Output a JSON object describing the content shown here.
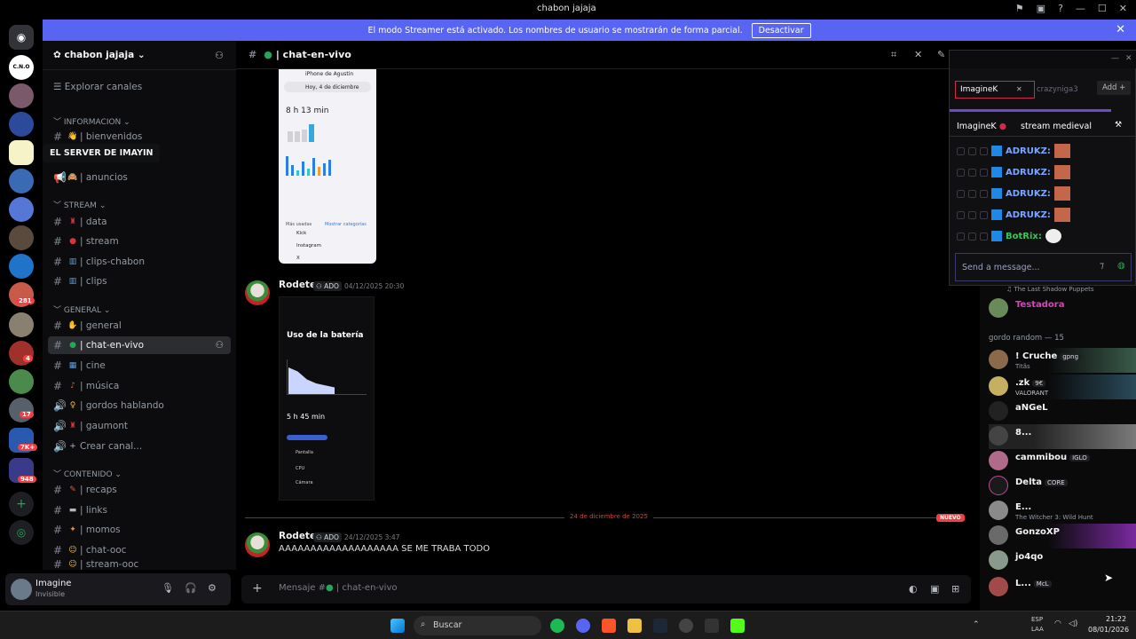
{
  "window": {
    "title": "chabon jajaja"
  },
  "banner": {
    "text": "El modo Streamer está activado. Los nombres de usuario se mostrarán de forma parcial.",
    "button": "Desactivar"
  },
  "rail": {
    "server1_label": "C.N.O",
    "badges": [
      "281",
      "4",
      "17",
      "7K+",
      "948"
    ],
    "tooltip": "EL SERVER DE IMAYIN"
  },
  "server": {
    "name": "chabon jajaja",
    "explore": "Explorar canales",
    "categories": {
      "info": "INFORMACION",
      "stream": "STREAM",
      "general": "GENERAL",
      "contenido": "CONTENIDO"
    },
    "channels": [
      {
        "label": "| bienvenidos"
      },
      {
        "label": "| anuncios"
      },
      {
        "label": "| data"
      },
      {
        "label": "| stream"
      },
      {
        "label": "| clips-chabon"
      },
      {
        "label": "| clips"
      },
      {
        "label": "| general"
      },
      {
        "label": "| chat-en-vivo"
      },
      {
        "label": "| cine"
      },
      {
        "label": "| música"
      },
      {
        "label": "| gordos hablando"
      },
      {
        "label": "| gaumont"
      },
      {
        "label": "Crear canal..."
      },
      {
        "label": "| recaps"
      },
      {
        "label": "| links"
      },
      {
        "label": "| momos"
      },
      {
        "label": "| chat-ooc"
      },
      {
        "label": "| stream-ooc"
      }
    ]
  },
  "user": {
    "name": "Imagine",
    "status": "Invisible"
  },
  "chat": {
    "channel": "| chat-en-vivo",
    "screenshot1": {
      "header": "iPhone de Agustin",
      "date": "Hoy, 4 de diciembre",
      "time": "8 h 13 min",
      "apps": [
        "Kick",
        "Instagram",
        "X"
      ],
      "link": "Mostrar categorías",
      "usage_label": "Más usadas"
    },
    "messages": [
      {
        "author": "Rodete",
        "tag": "ADO",
        "time": "04/12/2025 20:30",
        "text": ""
      },
      {
        "author": "Rodete",
        "tag": "ADO",
        "time": "24/12/2025 3:47",
        "text": "AAAAAAAAAAAAAAAAAAA SE ME TRABA TODO"
      }
    ],
    "screenshot2": {
      "title": "Uso de la batería",
      "value": "5 h 45 min",
      "items": [
        "Pantalla",
        "CPU",
        "Cámara"
      ]
    },
    "divider": {
      "date": "24 de diciembre de 2025",
      "tag": "NUEVO"
    },
    "composer_placeholder": "Mensaje #",
    "composer_channel": "| chat-en-vivo"
  },
  "overlay": {
    "tabs": [
      "ImagineK",
      "crazyniga3",
      "Add"
    ],
    "active_tab": "ImagineK",
    "stream_title": "stream medieval",
    "lines": [
      {
        "user": "ADRUKZ:"
      },
      {
        "user": "ADRUKZ:"
      },
      {
        "user": "ADRUKZ:"
      },
      {
        "user": "ADRUKZ:"
      },
      {
        "user": "BotRix:"
      }
    ],
    "input_placeholder": "Send a message..."
  },
  "members": {
    "top_activity": "The Last Shadow Puppets",
    "top_name": "Testadora",
    "section": "gordo random — 15",
    "list": [
      {
        "name": "! Cruche",
        "badge": "gpng",
        "sub": "Titãs"
      },
      {
        "name": ".zk",
        "badge": "9€",
        "sub": "VALORANT"
      },
      {
        "name": "aNGeL",
        "badge": "",
        "sub": ""
      },
      {
        "name": "8...",
        "badge": "",
        "sub": ""
      },
      {
        "name": "cammibou",
        "badge": "IGLO",
        "sub": ""
      },
      {
        "name": "Delta",
        "badge": "CORE",
        "sub": ""
      },
      {
        "name": "E...",
        "badge": "",
        "sub": "The Witcher 3: Wild Hunt"
      },
      {
        "name": "GonzoXP",
        "badge": "",
        "sub": ""
      },
      {
        "name": "jo4qo",
        "badge": "",
        "sub": ""
      },
      {
        "name": "L...",
        "badge": "McL",
        "sub": ""
      }
    ]
  },
  "taskbar": {
    "search": "Buscar",
    "lang1": "ESP",
    "lang2": "LAA",
    "time": "21:22",
    "date": "08/01/2026"
  },
  "colors": {
    "accent": "#5865f2",
    "red": "#f23f43",
    "green": "#23a55a"
  }
}
